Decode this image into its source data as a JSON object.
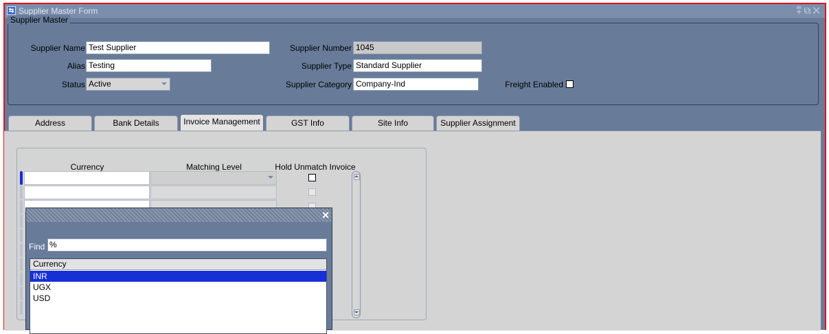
{
  "window": {
    "title": "Supplier Master Form",
    "controls": "⩱⧉✕"
  },
  "supplier": {
    "group_label": "Supplier Master",
    "name_label": "Supplier Name",
    "name_value": "Test Supplier",
    "alias_label": "Alias",
    "alias_value": "Testing",
    "status_label": "Status",
    "status_value": "Active",
    "number_label": "Supplier Number",
    "number_value": "1045",
    "type_label": "Supplier Type",
    "type_value": "Standard Supplier",
    "category_label": "Supplier Category",
    "category_value": "Company-Ind",
    "freight_label": "Freight Enabled"
  },
  "tabs": [
    {
      "label": "Address"
    },
    {
      "label": "Bank Details"
    },
    {
      "label": "Invoice Management"
    },
    {
      "label": "GST Info"
    },
    {
      "label": "Site Info"
    },
    {
      "label": "Supplier Assignment"
    }
  ],
  "invoice_grid": {
    "col_currency": "Currency",
    "col_matching": "Matching Level",
    "col_hold": "Hold Unmatch Invoice"
  },
  "lov": {
    "find_label": "Find",
    "find_value": "%",
    "column": "Currency",
    "rows": [
      "INR",
      "UGX",
      "USD"
    ],
    "close": "✕"
  }
}
